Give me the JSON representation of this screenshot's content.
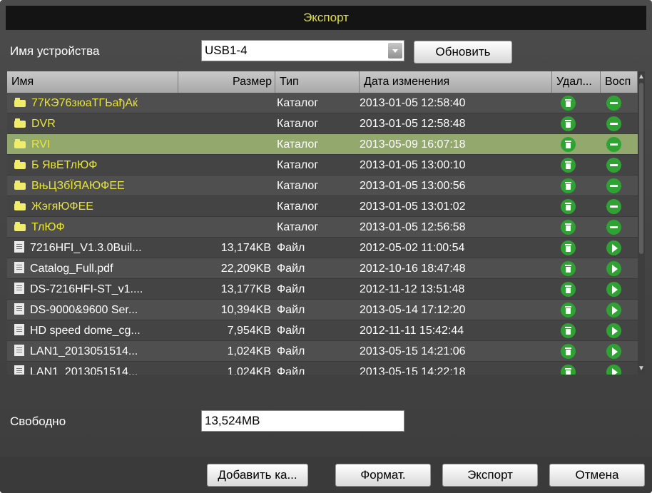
{
  "window": {
    "title": "Экспорт"
  },
  "device": {
    "label": "Имя устройства",
    "value": "USB1-4",
    "refresh_label": "Обновить"
  },
  "table": {
    "headers": {
      "name": "Имя",
      "size": "Размер",
      "type": "Тип",
      "date": "Дата изменения",
      "delete": "Удал...",
      "play": "Восп"
    },
    "rows": [
      {
        "kind": "folder",
        "name": "77КЭ76зюаТГЬађАќ",
        "size": "",
        "type": "Каталог",
        "date": "2013-01-05 12:58:40",
        "action": "minus",
        "selected": false
      },
      {
        "kind": "folder",
        "name": "DVR",
        "size": "",
        "type": "Каталог",
        "date": "2013-01-05 12:58:48",
        "action": "minus",
        "selected": false
      },
      {
        "kind": "folder",
        "name": "RVI",
        "size": "",
        "type": "Каталог",
        "date": "2013-05-09 16:07:18",
        "action": "minus",
        "selected": true
      },
      {
        "kind": "folder",
        "name": "Б ЯвЕТлЮФ",
        "size": "",
        "type": "Каталог",
        "date": "2013-01-05 13:00:10",
        "action": "minus",
        "selected": false
      },
      {
        "kind": "folder",
        "name": "ВњЦЗбЇЯАЮФЕЕ",
        "size": "",
        "type": "Каталог",
        "date": "2013-01-05 13:00:56",
        "action": "minus",
        "selected": false
      },
      {
        "kind": "folder",
        "name": "ЖэгяЮФЕЕ",
        "size": "",
        "type": "Каталог",
        "date": "2013-01-05 13:01:02",
        "action": "minus",
        "selected": false
      },
      {
        "kind": "folder",
        "name": "ТлЮФ",
        "size": "",
        "type": "Каталог",
        "date": "2013-01-05 12:56:58",
        "action": "minus",
        "selected": false
      },
      {
        "kind": "file",
        "name": "7216HFI_V1.3.0Buil...",
        "size": "13,174KB",
        "type": "Файл",
        "date": "2012-05-02 11:00:54",
        "action": "play",
        "selected": false
      },
      {
        "kind": "file",
        "name": "Catalog_Full.pdf",
        "size": "22,209KB",
        "type": "Файл",
        "date": "2012-10-16 18:47:48",
        "action": "play",
        "selected": false
      },
      {
        "kind": "file",
        "name": "DS-7216HFI-ST_v1....",
        "size": "13,177KB",
        "type": "Файл",
        "date": "2012-11-12 13:51:48",
        "action": "play",
        "selected": false
      },
      {
        "kind": "file",
        "name": "DS-9000&9600 Ser...",
        "size": "10,394KB",
        "type": "Файл",
        "date": "2013-05-14 17:12:20",
        "action": "play",
        "selected": false
      },
      {
        "kind": "file",
        "name": "HD speed dome_cg...",
        "size": "7,954KB",
        "type": "Файл",
        "date": "2012-11-11 15:42:44",
        "action": "play",
        "selected": false
      },
      {
        "kind": "file",
        "name": "LAN1_2013051514...",
        "size": "1,024KB",
        "type": "Файл",
        "date": "2013-05-15 14:21:06",
        "action": "play",
        "selected": false
      },
      {
        "kind": "file",
        "name": "LAN1_2013051514...",
        "size": "1,024KB",
        "type": "Файл",
        "date": "2013-05-15 14:22:18",
        "action": "play",
        "selected": false
      }
    ]
  },
  "free": {
    "label": "Свободно",
    "value": "13,524MB"
  },
  "buttons": {
    "add_folder": "Добавить ка...",
    "format": "Формат.",
    "export": "Экспорт",
    "cancel": "Отмена"
  },
  "colors": {
    "title_text": "#e2df3a",
    "folder_text": "#e8e53a",
    "selected_row": "#93a86d",
    "action_green": "#2fa233"
  }
}
